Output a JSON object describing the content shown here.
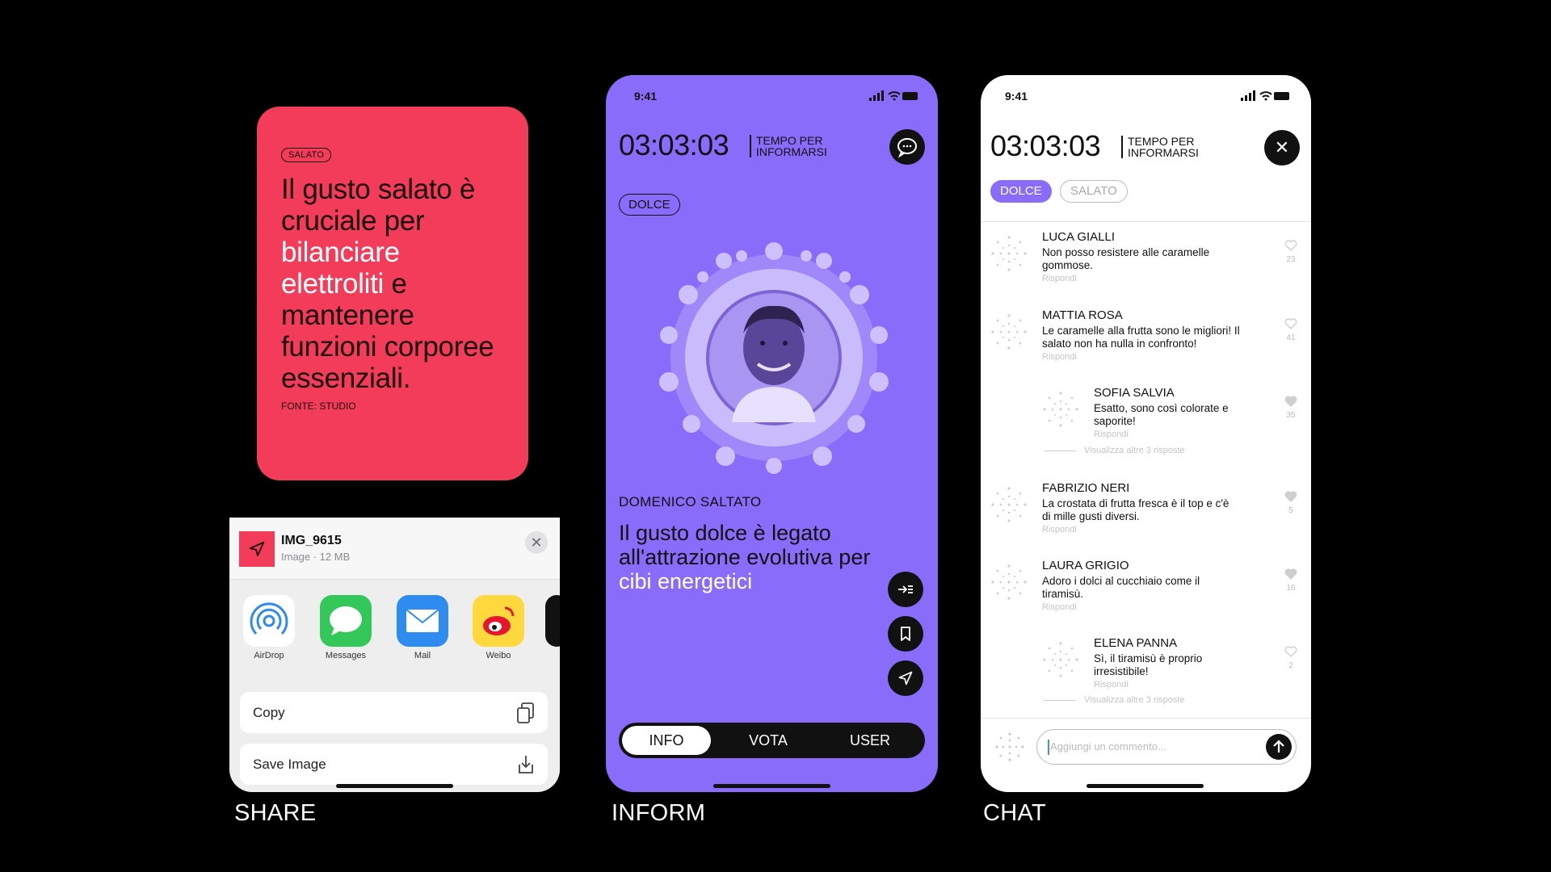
{
  "share": {
    "caption": "SHARE",
    "card": {
      "tag": "SALATO",
      "quote_part1": "Il gusto salato è cruciale per ",
      "quote_highlight1": "bilanciare elettroliti",
      "quote_part2": " e mantenere funzioni corporee essenziali.",
      "source": "FONTE: STUDIO",
      "bg_color": "#f33c59"
    },
    "sheet": {
      "file_name": "IMG_9615",
      "file_meta": "Image · 12 MB",
      "close_icon": "close-icon",
      "apps": [
        {
          "label": "AirDrop",
          "icon": "airdrop-icon"
        },
        {
          "label": "Messages",
          "icon": "messages-icon"
        },
        {
          "label": "Mail",
          "icon": "mail-icon"
        },
        {
          "label": "Weibo",
          "icon": "weibo-icon"
        }
      ],
      "actions": [
        {
          "label": "Copy",
          "icon": "copy-icon"
        },
        {
          "label": "Save Image",
          "icon": "save-icon"
        }
      ]
    }
  },
  "inform": {
    "caption": "INFORM",
    "status_time": "9:41",
    "timer": "03:03:03",
    "timer_label_line1": "TEMPO PER",
    "timer_label_line2": "INFORMARSI",
    "tag": "DOLCE",
    "speaker": "DOMENICO SALTATO",
    "statement_part1": "Il gusto dolce è legato all'attrazione evolutiva per ",
    "statement_highlight": "cibi energetici",
    "tabs": [
      "INFO",
      "VOTA",
      "USER"
    ],
    "active_tab": "INFO",
    "bg_color": "#8a6cfa"
  },
  "chat": {
    "caption": "CHAT",
    "status_time": "9:41",
    "timer": "03:03:03",
    "timer_label_line1": "TEMPO PER",
    "timer_label_line2": "INFORMARSI",
    "filters": [
      "DOLCE",
      "SALATO"
    ],
    "active_filter": "DOLCE",
    "reply_label": "Rispondi",
    "more_replies": "Visualizza altre 3 risposte",
    "comments": [
      {
        "name": "LUCA GIALLI",
        "line1": "Non posso resistere alle caramelle",
        "line2": "gommose.",
        "likes": "23",
        "liked": false,
        "reply": false
      },
      {
        "name": "MATTIA ROSA",
        "line1": "Le caramelle alla frutta sono le migliori! Il",
        "line2": "salato non ha nulla in confronto!",
        "likes": "41",
        "liked": false,
        "reply": false
      },
      {
        "name": "SOFIA SALVIA",
        "line1": "Esatto, sono così colorate e",
        "line2": "saporite!",
        "likes": "35",
        "liked": true,
        "reply": true
      },
      {
        "name": "FABRIZIO NERI",
        "line1": "La crostata di frutta fresca è il top e c'è",
        "line2": "di mille gusti diversi.",
        "likes": "5",
        "liked": true,
        "reply": false
      },
      {
        "name": "LAURA GRIGIO",
        "line1": "Adoro i dolci al cucchiaio come il",
        "line2": "tiramisù.",
        "likes": "16",
        "liked": true,
        "reply": false
      },
      {
        "name": "ELENA PANNA",
        "line1": "Sì, il tiramisù è proprio",
        "line2": "irresistibile!",
        "likes": "2",
        "liked": false,
        "reply": true
      }
    ],
    "input_placeholder": "Aggiungi un commento..."
  }
}
